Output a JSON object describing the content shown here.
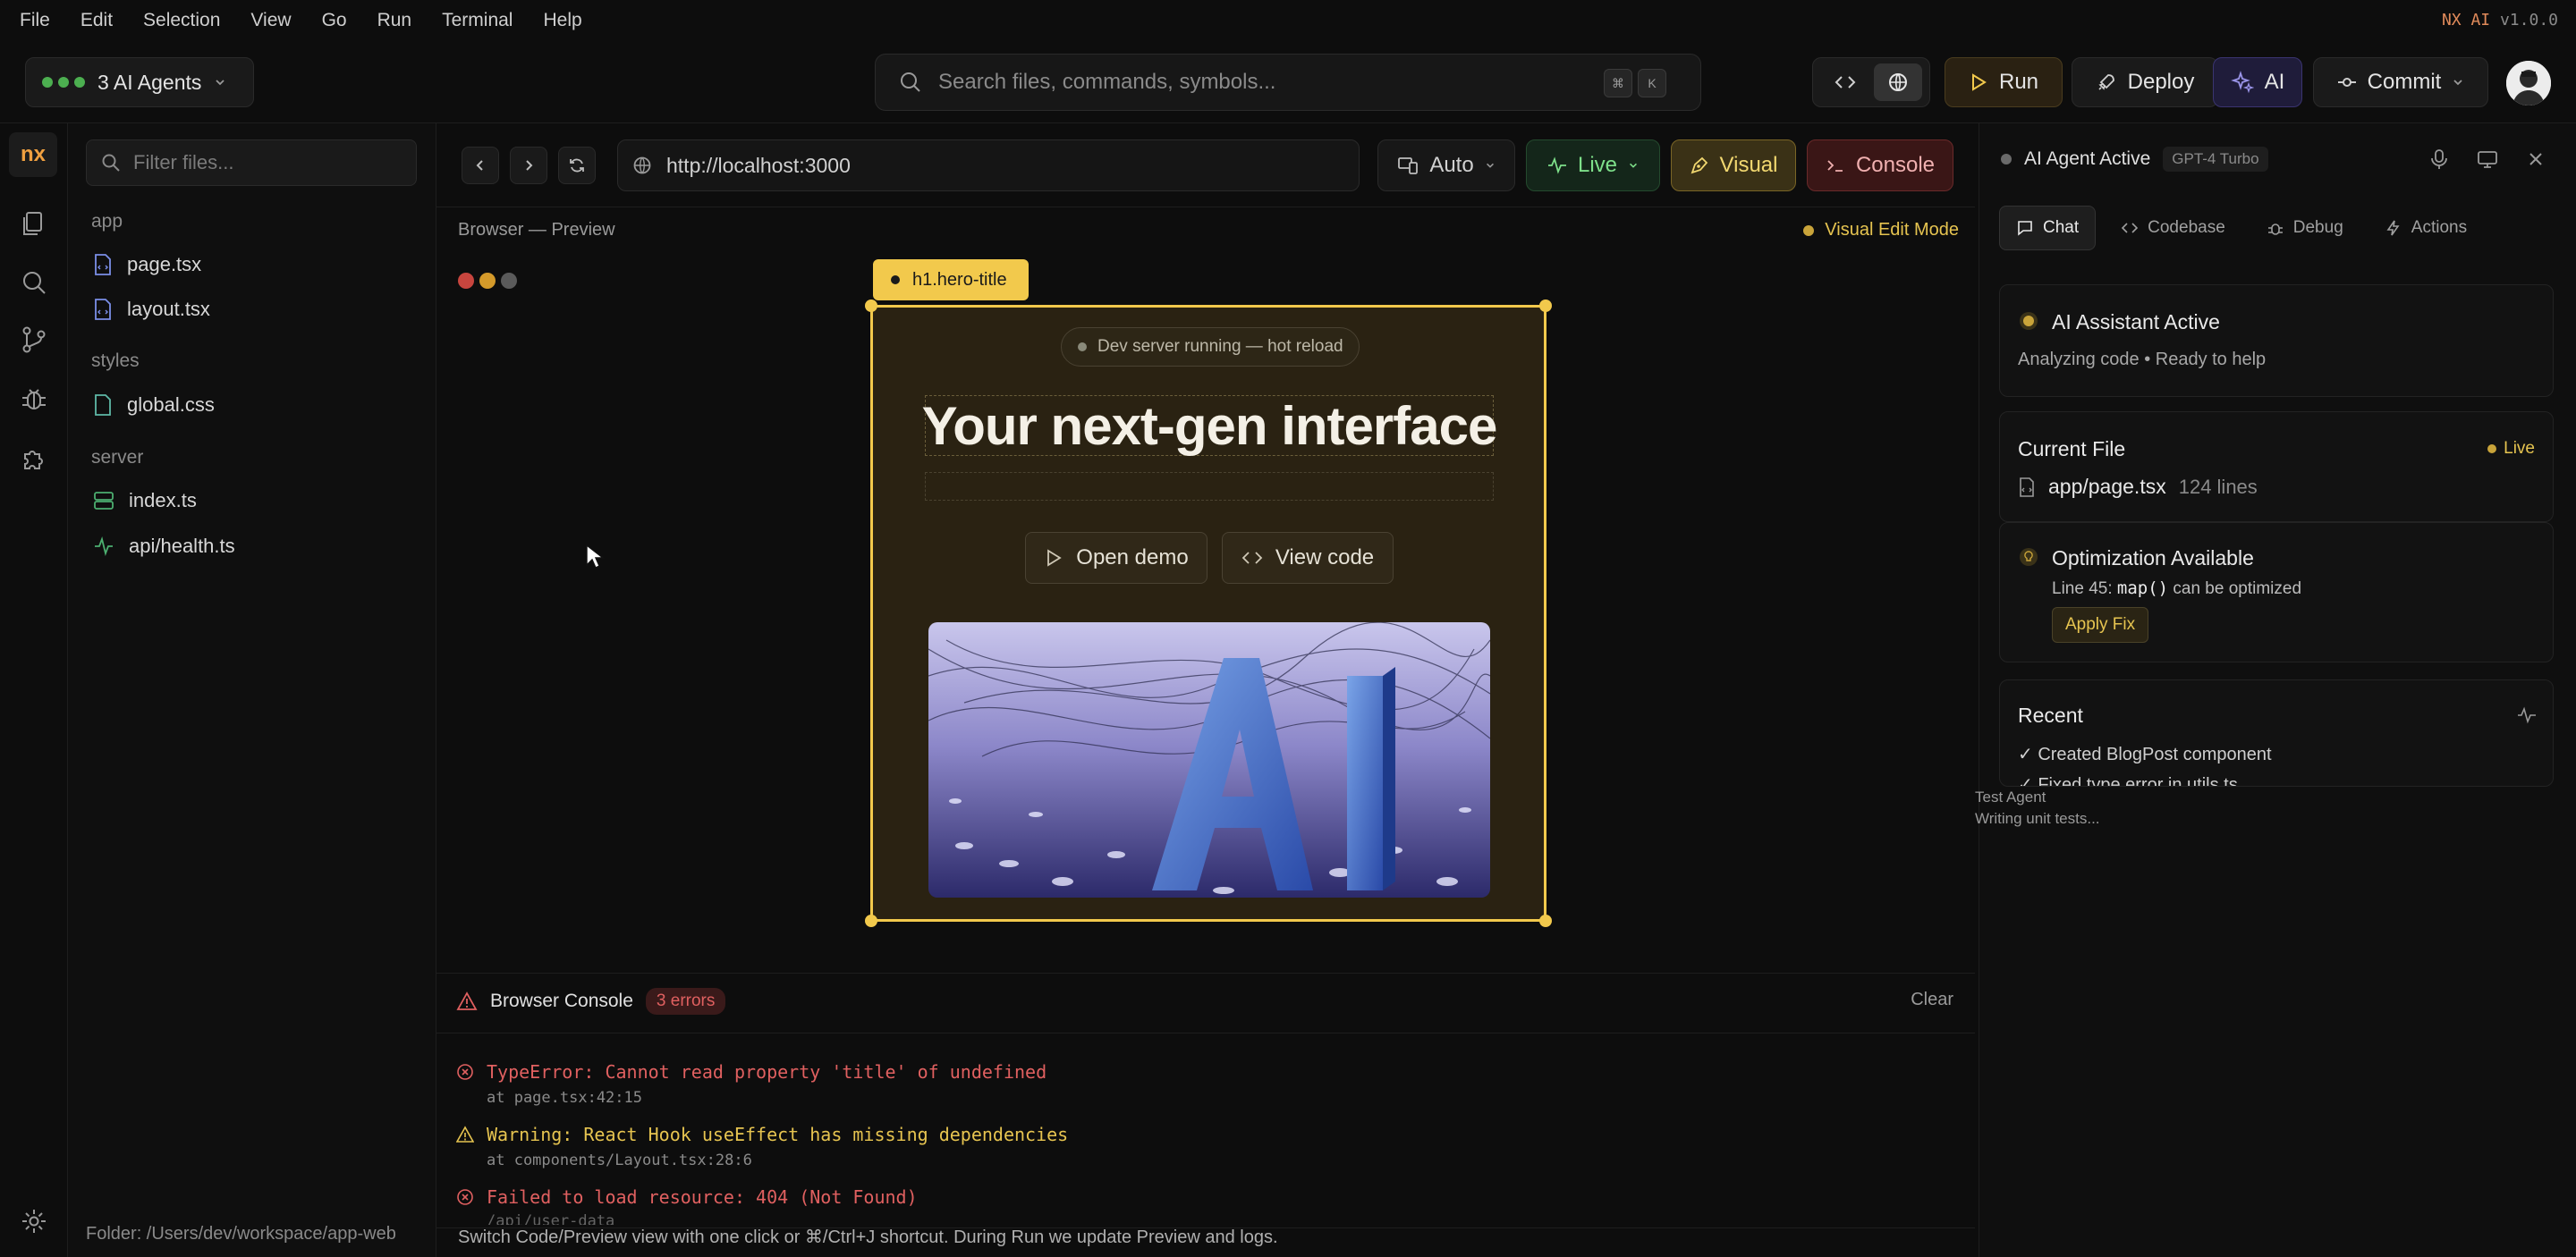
{
  "menubar": {
    "items": [
      "File",
      "Edit",
      "Selection",
      "View",
      "Go",
      "Run",
      "Terminal",
      "Help"
    ],
    "brand": "NX AI",
    "version": "v1.0.0"
  },
  "topbar": {
    "agents_label": "3 AI Agents",
    "search_placeholder": "Search files, commands, symbols...",
    "shortcut_keys": [
      "⌘",
      "K"
    ],
    "run_label": "Run",
    "deploy_label": "Deploy",
    "ai_label": "AI",
    "commit_label": "Commit"
  },
  "activity": {
    "logo": "nx",
    "icons": [
      "files-icon",
      "search-icon",
      "git-branch-icon",
      "bug-icon",
      "extensions-icon",
      "settings-icon"
    ]
  },
  "explorer": {
    "filter_placeholder": "Filter files...",
    "groups": [
      {
        "name": "app",
        "files": [
          {
            "name": "page.tsx",
            "icon": "tsx-file-icon"
          },
          {
            "name": "layout.tsx",
            "icon": "tsx-file-icon"
          }
        ]
      },
      {
        "name": "styles",
        "files": [
          {
            "name": "global.css",
            "icon": "css-file-icon"
          }
        ]
      },
      {
        "name": "server",
        "files": [
          {
            "name": "index.ts",
            "icon": "server-file-icon"
          },
          {
            "name": "api/health.ts",
            "icon": "activity-file-icon"
          }
        ]
      }
    ],
    "folder": "Folder: /Users/dev/workspace/app-web"
  },
  "center": {
    "url": "http://localhost:3000",
    "viewport_label": "Auto",
    "live_label": "Live",
    "visual_label": "Visual",
    "console_label": "Console",
    "browser_title": "Browser — Preview",
    "visual_edit_mode": "Visual Edit Mode",
    "selected_element": "h1.hero-title",
    "preview": {
      "dev_server": "Dev server running — hot reload",
      "hero_title": "Your next-gen interface",
      "open_demo": "Open demo",
      "view_code": "View code"
    }
  },
  "console": {
    "title": "Browser Console",
    "error_count": "3 errors",
    "clear_label": "Clear",
    "lines": [
      {
        "type": "error",
        "message": "TypeError: Cannot read property 'title' of undefined",
        "location": "at page.tsx:42:15"
      },
      {
        "type": "warning",
        "message": "Warning: React Hook useEffect has missing dependencies",
        "location": "at components/Layout.tsx:28:6"
      },
      {
        "type": "error",
        "message": "Failed to load resource: 404 (Not Found)",
        "location": "/api/user-data"
      }
    ],
    "tip": "Switch Code/Preview view with one click or ⌘/Ctrl+J shortcut. During Run we update Preview and logs."
  },
  "right": {
    "header": "AI Agent Active",
    "model": "GPT-4 Turbo",
    "tabs": [
      "Chat",
      "Codebase",
      "Debug",
      "Actions"
    ],
    "assistant_card": {
      "title": "AI Assistant Active",
      "subtitle": "Analyzing code • Ready to help"
    },
    "current_file_card": {
      "title": "Current File",
      "badge": "Live",
      "file": "app/page.tsx",
      "lines": "124 lines"
    },
    "optimization_card": {
      "title": "Optimization Available",
      "line_prefix": "Line 45:",
      "code": "map()",
      "line_suffix": "can be optimized",
      "action": "Apply Fix"
    },
    "recent_card": {
      "title": "Recent",
      "items": [
        "✓ Created BlogPost component",
        "✓ Fixed type error in utils.ts"
      ]
    },
    "test_agent": {
      "name": "Test Agent",
      "status": "Writing unit tests..."
    }
  },
  "colors": {
    "accent_yellow": "#f2c94c",
    "live_green": "#4caf50",
    "error_red": "#e06060",
    "warning_yellow": "#e6c450",
    "ai_purple": "#2a2550"
  }
}
